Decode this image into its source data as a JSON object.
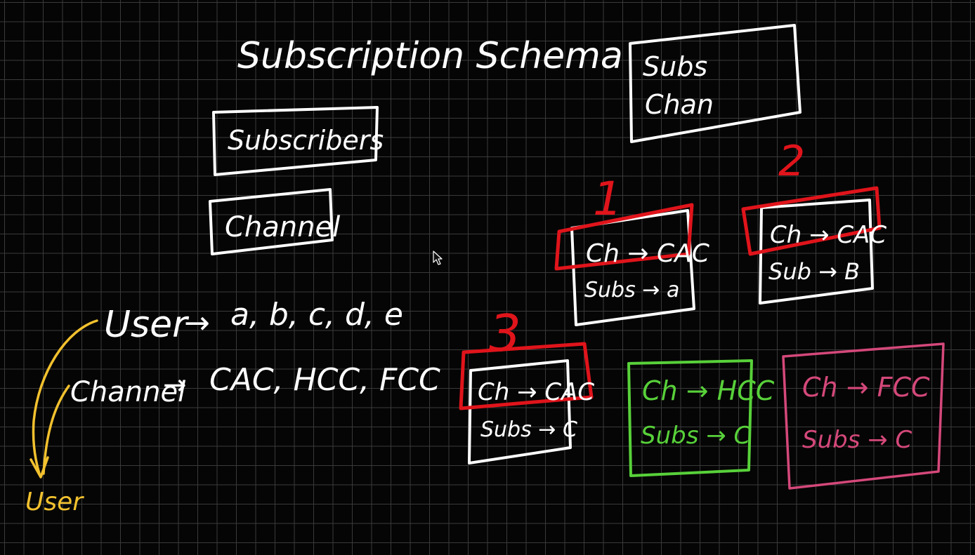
{
  "title": "Subscription Schema",
  "tables": {
    "subscribers": "Subscribers",
    "channel": "Channel"
  },
  "combined_box": {
    "line1": "Subs",
    "line2": "Chan"
  },
  "mapping": {
    "user_label": "User",
    "user_arrow": "→",
    "user_values": "a, b, c, d, e",
    "channel_label": "Channel",
    "channel_arrow": "→",
    "channel_values": "CAC, HCC, FCC",
    "result_label": "User"
  },
  "records": [
    {
      "number": "1",
      "ch": "Ch → CAC",
      "subs": "Subs → a"
    },
    {
      "number": "2",
      "ch": "Ch → CAC",
      "subs": "Sub → B"
    },
    {
      "number": "3",
      "ch": "Ch → CAC",
      "subs": "Subs → C"
    },
    {
      "number": "",
      "ch": "Ch → HCC",
      "subs": "Subs → C"
    },
    {
      "number": "",
      "ch": "Ch → FCC",
      "subs": "Subs → C"
    }
  ],
  "colors": {
    "background": "#050505",
    "grid": "#3a3a3a",
    "ink_white": "#ffffff",
    "ink_red": "#e0141b",
    "ink_yellow": "#f2c12e",
    "ink_green": "#58d13a",
    "ink_pink": "#d4487a"
  }
}
